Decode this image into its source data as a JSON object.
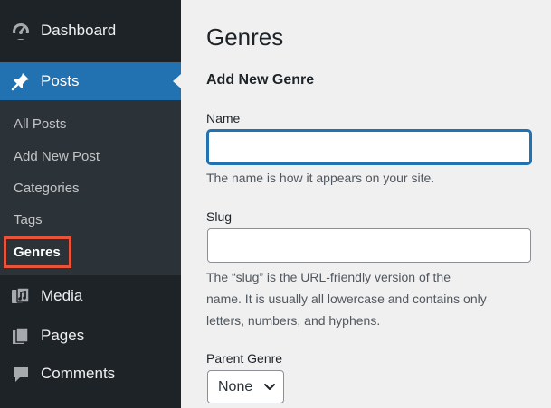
{
  "sidebar": {
    "dashboard": {
      "label": "Dashboard",
      "icon": "dashboard-icon"
    },
    "posts": {
      "label": "Posts",
      "icon": "pushpin-icon"
    },
    "submenu": [
      "All Posts",
      "Add New Post",
      "Categories",
      "Tags",
      "Genres"
    ],
    "media": {
      "label": "Media",
      "icon": "media-icon"
    },
    "pages": {
      "label": "Pages",
      "icon": "pages-icon"
    },
    "comments": {
      "label": "Comments",
      "icon": "comments-icon"
    },
    "highlight_color": "#e8533a",
    "active_color": "#2271b1"
  },
  "main": {
    "title": "Genres",
    "section_title": "Add New Genre",
    "name": {
      "label": "Name",
      "value": "",
      "help": "The name is how it appears on your site."
    },
    "slug": {
      "label": "Slug",
      "value": "",
      "help_lines": [
        "The “slug” is the URL-friendly version of the",
        "name. It is usually all lowercase and contains only",
        "letters, numbers, and hyphens."
      ]
    },
    "parent": {
      "label": "Parent Genre",
      "selected": "None"
    }
  }
}
